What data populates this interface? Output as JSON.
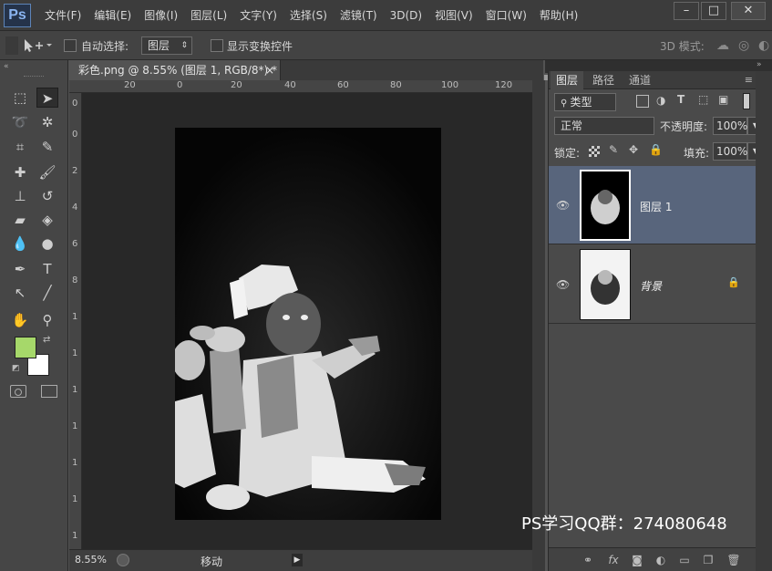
{
  "app": {
    "logo": "Ps",
    "menus": [
      "文件(F)",
      "编辑(E)",
      "图像(I)",
      "图层(L)",
      "文字(Y)",
      "选择(S)",
      "滤镜(T)",
      "3D(D)",
      "视图(V)",
      "窗口(W)",
      "帮助(H)"
    ],
    "window_buttons": {
      "minimize": "–",
      "restore": "□",
      "close": "✕"
    }
  },
  "options": {
    "auto_select_label": "自动选择:",
    "auto_select_target": "图层",
    "show_transform_label": "显示变换控件",
    "mode_3d_label": "3D 模式:"
  },
  "document": {
    "tab_title": "彩色.png @ 8.55% (图层 1, RGB/8*) *",
    "tab_close": "×",
    "ruler_h": [
      "20",
      "0",
      "20",
      "40",
      "60",
      "80",
      "100",
      "120"
    ],
    "ruler_v": [
      "0",
      "0",
      "2",
      "4",
      "6",
      "8",
      "1",
      "1",
      "1",
      "1",
      "1",
      "1",
      "1"
    ],
    "zoom": "8.55%",
    "status_text": "移动"
  },
  "layers_panel": {
    "tabs": [
      "图层",
      "路径",
      "通道"
    ],
    "filter_label": "类型",
    "blend_mode": "正常",
    "opacity_label": "不透明度:",
    "opacity_value": "100%",
    "lock_label": "锁定:",
    "fill_label": "填充:",
    "fill_value": "100%",
    "layers": [
      {
        "name": "图层 1",
        "selected": true,
        "visible": true
      },
      {
        "name": "背景",
        "selected": false,
        "visible": true,
        "locked": true
      }
    ]
  },
  "colors": {
    "foreground": "#a6d86a",
    "background": "#ffffff",
    "selected_layer": "#58657c"
  },
  "watermark": "PS学习QQ群：274080648"
}
